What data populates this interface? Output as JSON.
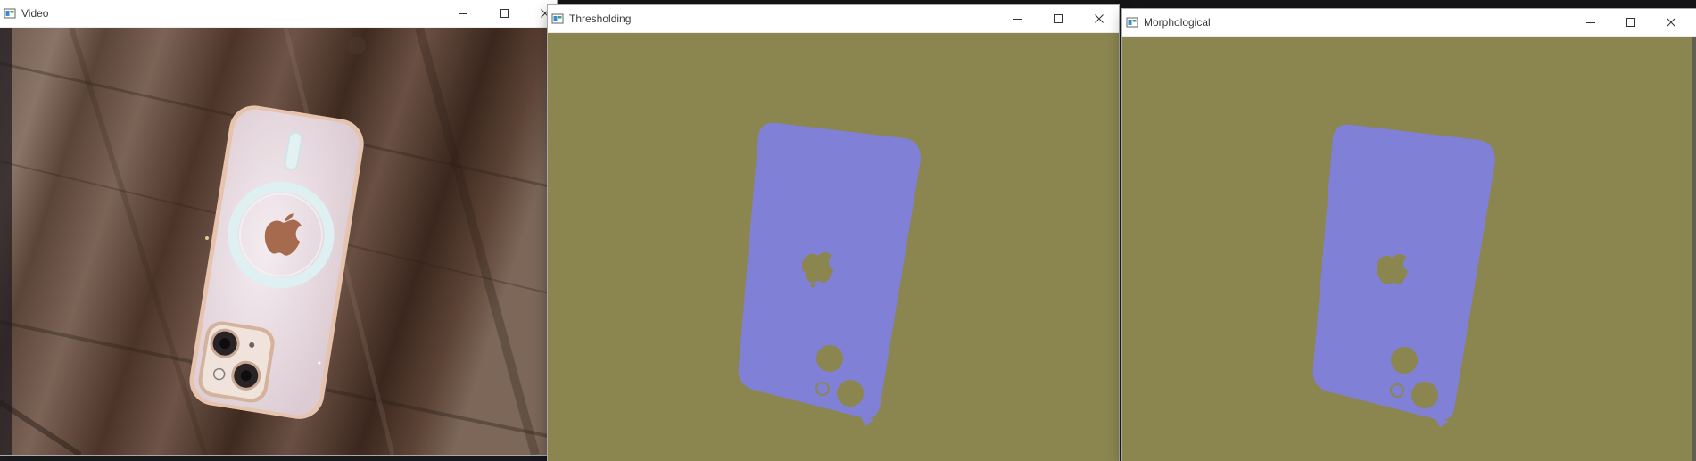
{
  "windows": [
    {
      "id": "video",
      "title": "Video",
      "buttons": [
        "minimize",
        "maximize",
        "close"
      ]
    },
    {
      "id": "thresholding",
      "title": "Thresholding",
      "buttons": [
        "minimize",
        "maximize",
        "close"
      ]
    },
    {
      "id": "morphological",
      "title": "Morphological",
      "buttons": [
        "minimize",
        "maximize",
        "close"
      ]
    }
  ],
  "colors": {
    "mask_background": "#8b8650",
    "mask_foreground": "#7f80d6",
    "wood_dark": "#4a3328",
    "wood_light": "#8a7466",
    "phone_case": "#ece2e7",
    "magsafe_ring": "#dceff2",
    "apple_logo": "#a66a4f"
  },
  "icons": {
    "app": "opencv-window-icon",
    "minimize": "minimize-icon",
    "maximize": "maximize-icon",
    "close": "close-icon"
  }
}
